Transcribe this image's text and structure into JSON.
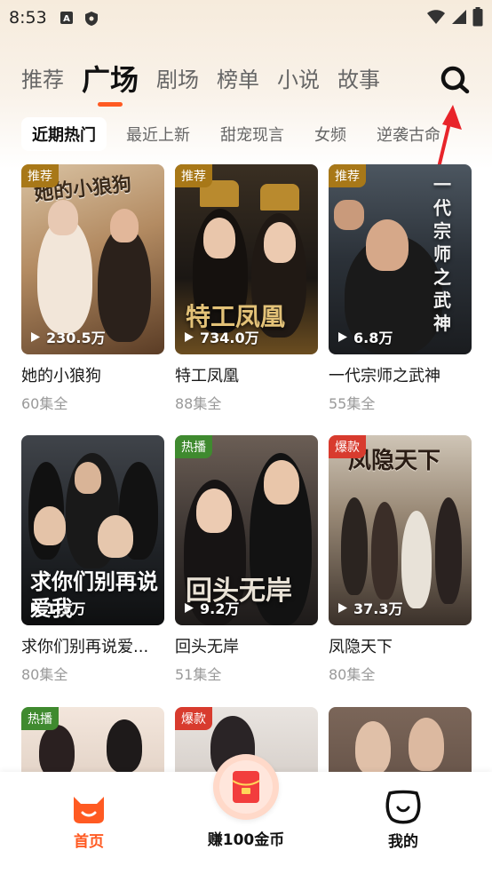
{
  "status_bar": {
    "time": "8:53"
  },
  "main_tabs": [
    {
      "label": "推荐",
      "active": false
    },
    {
      "label": "广场",
      "active": true
    },
    {
      "label": "剧场",
      "active": false
    },
    {
      "label": "榜单",
      "active": false
    },
    {
      "label": "小说",
      "active": false
    },
    {
      "label": "故事",
      "active": false
    }
  ],
  "chips": [
    {
      "label": "近期热门",
      "active": true
    },
    {
      "label": "最近上新",
      "active": false
    },
    {
      "label": "甜宠现言",
      "active": false
    },
    {
      "label": "女频",
      "active": false
    },
    {
      "label": "逆袭古命",
      "active": false
    }
  ],
  "cards": [
    {
      "tag": "推荐",
      "tag_color": "#a87818",
      "plays": "230.5万",
      "title": "她的小狼狗",
      "episodes": "60集全",
      "poster_text": "她的小狼狗"
    },
    {
      "tag": "推荐",
      "tag_color": "#a87818",
      "plays": "734.0万",
      "title": "特工凤凰",
      "episodes": "88集全",
      "poster_text": "特工凤凰"
    },
    {
      "tag": "推荐",
      "tag_color": "#a87818",
      "plays": "6.8万",
      "title": "一代宗师之武神",
      "episodes": "55集全",
      "poster_text": "一代宗师之武神"
    },
    {
      "tag": "",
      "tag_color": "",
      "plays": "1.5万",
      "title": "求你们别再说爱...",
      "episodes": "80集全",
      "poster_text": "求你们别再说爱我"
    },
    {
      "tag": "热播",
      "tag_color": "#3f8a2f",
      "plays": "9.2万",
      "title": "回头无岸",
      "episodes": "51集全",
      "poster_text": "回头无岸"
    },
    {
      "tag": "爆款",
      "tag_color": "#d83b2e",
      "plays": "37.3万",
      "title": "凤隐天下",
      "episodes": "80集全",
      "poster_text": "凤隐天下"
    },
    {
      "tag": "热播",
      "tag_color": "#3f8a2f",
      "plays": "",
      "title": "",
      "episodes": "",
      "poster_text": ""
    },
    {
      "tag": "爆款",
      "tag_color": "#d83b2e",
      "plays": "",
      "title": "",
      "episodes": "",
      "poster_text": ""
    },
    {
      "tag": "",
      "tag_color": "",
      "plays": "",
      "title": "",
      "episodes": "",
      "poster_text": ""
    }
  ],
  "bottom_nav": {
    "home_label": "首页",
    "earn_label": "赚100金币",
    "mine_label": "我的"
  },
  "colors": {
    "accent": "#ff5a22"
  }
}
